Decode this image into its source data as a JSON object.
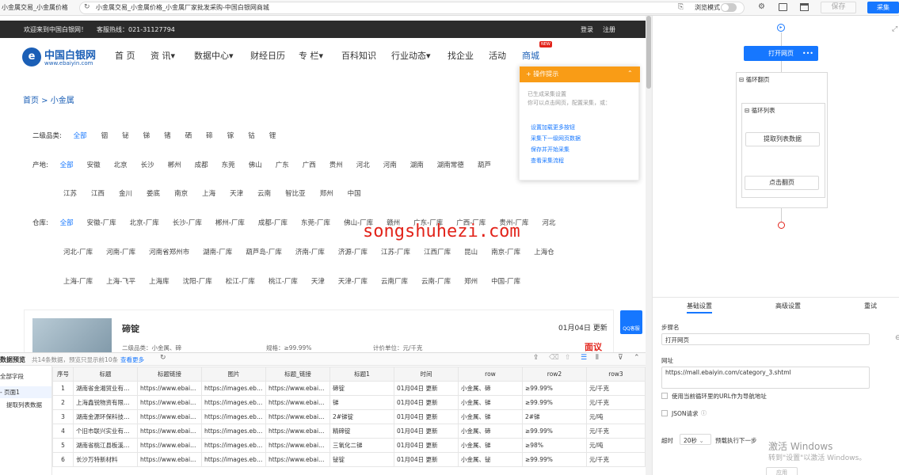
{
  "browser": {
    "tab_title": "小金属交易_小金属价格",
    "address": "小金属交易_小金属价格_小金属厂家批发采购-中国白银网商城",
    "browse_mode": "浏览模式",
    "save_label": "保存",
    "collect_label": "采集"
  },
  "site": {
    "welcome": "欢迎来到中国白银网！",
    "hotline": "客服热线：021-31127794",
    "login": "登录",
    "register": "注册",
    "logo_text": "中国白银网",
    "logo_sub": "www.ebaiyin.com",
    "nav": [
      "首 页",
      "资 讯▾",
      "数据中心▾",
      "财经日历",
      "专 栏▾",
      "百科知识",
      "行业动态▾",
      "找企业",
      "活动",
      "商城"
    ],
    "new_badge": "NEW",
    "breadcrumb": "首页  >  小金属",
    "level2_label": "二级品类:",
    "level2": [
      "全部",
      "铟",
      "铋",
      "锑",
      "锗",
      "硒",
      "碲",
      "镓",
      "钴",
      "锂"
    ],
    "origin_label": "产地:",
    "origin_row1": [
      "全部",
      "安徽",
      "北京",
      "长沙",
      "郴州",
      "成都",
      "东莞",
      "佛山",
      "广东",
      "广西",
      "贵州",
      "河北",
      "河南",
      "湖南",
      "湖南常德",
      "葫芦"
    ],
    "origin_row2": [
      "江苏",
      "江西",
      "金川",
      "娄底",
      "南京",
      "上海",
      "天津",
      "云南",
      "智比亚",
      "郑州",
      "中国"
    ],
    "warehouse_label": "仓库:",
    "wh_row1": [
      "全部",
      "安徽-厂库",
      "北京-厂库",
      "长沙-厂库",
      "郴州-厂库",
      "成都-厂库",
      "东莞-厂库",
      "佛山-厂库",
      "赣州",
      "广东-厂库",
      "广西-厂库",
      "贵州-厂库",
      "河北"
    ],
    "wh_row2": [
      "河北-厂库",
      "河南-厂库",
      "河南省郑州市",
      "湖南-厂库",
      "葫芦岛-厂库",
      "济南-厂库",
      "济源-厂库",
      "江苏-厂库",
      "江西厂库",
      "昆山",
      "南京-厂库",
      "上海仓"
    ],
    "wh_row3": [
      "上海-厂库",
      "上海-飞平",
      "上海库",
      "沈阳-厂库",
      "松江-厂库",
      "桃江-厂库",
      "天津",
      "天津-厂库",
      "云南厂库",
      "云南-厂库",
      "郑州",
      "中国-厂库"
    ],
    "card_title": "碲锭",
    "card_date": "01月04日 更新",
    "card_cat": "二级品类：小金属、碲",
    "card_spec": "规格：≥99.99%",
    "card_unit": "计价单位：元/千克",
    "card_price": "面议",
    "qq_label": "QQ客服",
    "watermark": "songshuhezi.com"
  },
  "popup": {
    "title": "+ 操作提示",
    "desc1": "已生成采集设置",
    "desc2": "你可以点击网页，配置采集，或：",
    "links": [
      "设置加载更多按钮",
      "采集下一级网页数据",
      "保存并开始采集",
      "查看采集流程"
    ]
  },
  "bottom": {
    "title": "数据预览",
    "summary": "共14条数据，预览只显示前10条",
    "view_more": "查看更多",
    "side_all": "全部字段",
    "side_page": "- 页面1",
    "side_extract": "提取列表数据",
    "columns": [
      "序号",
      "标题",
      "标题链接",
      "图片",
      "标题_链接",
      "标题1",
      "时间",
      "row",
      "row2",
      "row3"
    ],
    "rows": [
      [
        "1",
        "湖南省金湘贸业有限...",
        "https://www.ebaiyin...",
        "https://images.ebaiyi...",
        "https://www.ebaiyin...",
        "碲锭",
        "01月04日 更新",
        "小金属、碲",
        "≥99.99%",
        "元/千克"
      ],
      [
        "2",
        "上海鑫锐物资有限公司",
        "https://www.ebaiyin...",
        "https://images.ebaiyi...",
        "https://www.ebaiyin...",
        "锑",
        "01月04日 更新",
        "小金属、锑",
        "≥99.99%",
        "元/千克"
      ],
      [
        "3",
        "湖南金源环保科技有...",
        "https://www.ebaiyin...",
        "https://images.ebaiyi...",
        "https://www.ebaiyin...",
        "2#锑锭",
        "01月04日 更新",
        "小金属、锑",
        "2#锑",
        "元/吨"
      ],
      [
        "4",
        "个旧市联兴实业有限...",
        "https://www.ebaiyin...",
        "https://images.ebaiyi...",
        "https://www.ebaiyin...",
        "精碲锭",
        "01月04日 更新",
        "小金属、碲",
        "≥99.99%",
        "元/千克"
      ],
      [
        "5",
        "湖南省桃江县板溪锑...",
        "https://www.ebaiyin...",
        "https://images.ebaiyi...",
        "https://www.ebaiyin...",
        "三氧化二锑",
        "01月04日 更新",
        "小金属、锑",
        "≥98%",
        "元/吨"
      ],
      [
        "6",
        "长沙万特新材料",
        "https://www.ebaiyin...",
        "https://images.ebaiyi...",
        "https://www.ebaiyin...",
        "铋锭",
        "01月04日 更新",
        "小金属、铋",
        "≥99.99%",
        "元/千克"
      ]
    ]
  },
  "rpanel": {
    "open_page": "打开网页",
    "loop_page": "循环翻页",
    "loop_list": "循环列表",
    "extract": "提取列表数据",
    "click_next": "点击翻页",
    "tabs": [
      "基础设置",
      "高级设置",
      "重试"
    ],
    "step_name_label": "步骤名",
    "step_name": "打开网页",
    "url_label": "网址",
    "url": "https://mall.ebaiyin.com/category_3.shtml",
    "use_loop_url": "使用当前循环里的URL作为导航地址",
    "json_req": "JSON请求",
    "timeout_label": "超时",
    "timeout_value": "20秒",
    "timeout_suffix": "预载执行下一步",
    "win1": "激活 Windows",
    "win2": "转到\"设置\"以激活 Windows。",
    "apply": "应用"
  }
}
